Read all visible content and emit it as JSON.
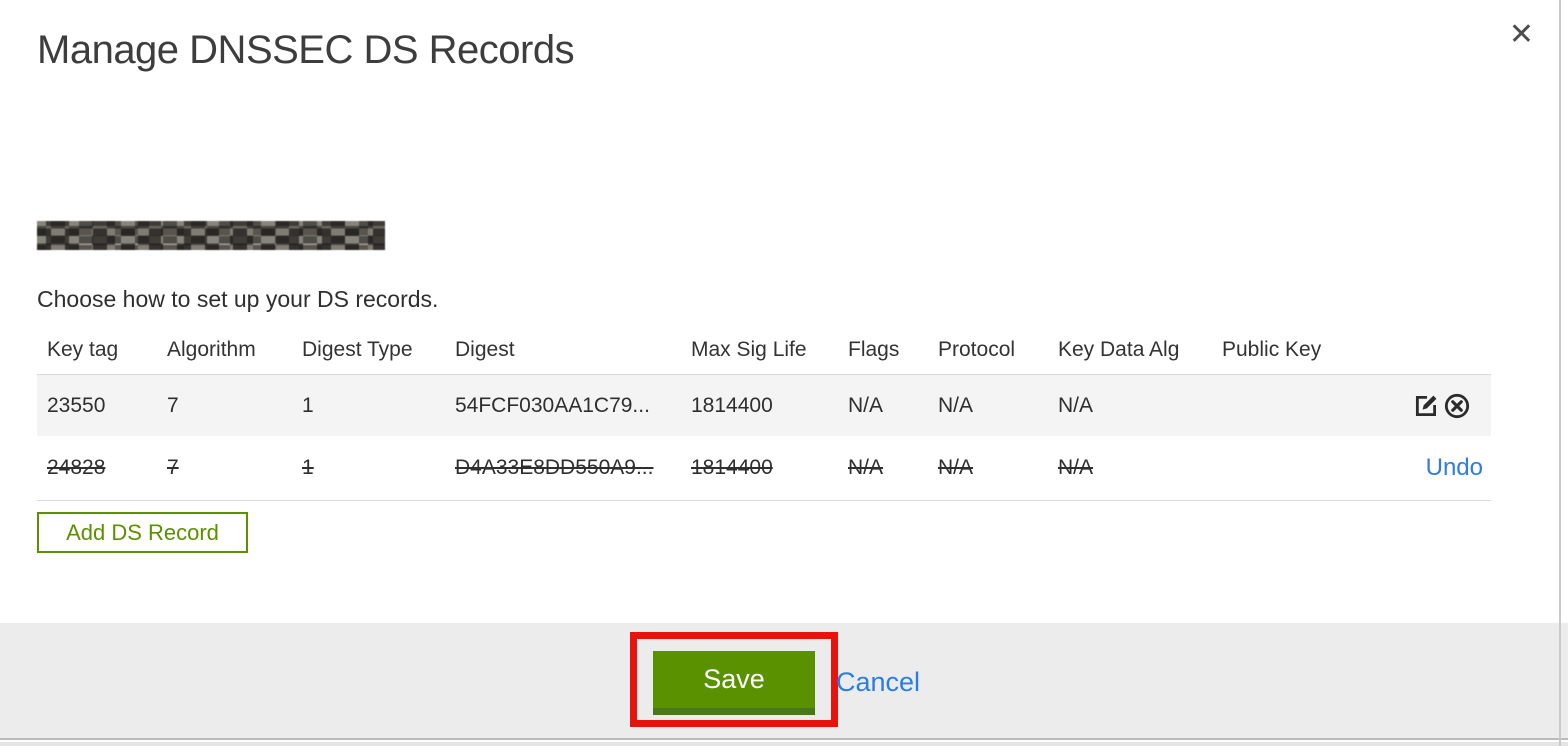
{
  "modal": {
    "title": "Manage DNSSEC DS Records",
    "close_icon": "✕",
    "subtitle": "Choose how to set up your DS records.",
    "domain_name_redacted": "pixelated-blurred-domain"
  },
  "table": {
    "headers": [
      "Key tag",
      "Algorithm",
      "Digest Type",
      "Digest",
      "Max Sig Life",
      "Flags",
      "Protocol",
      "Key Data Alg",
      "Public Key"
    ],
    "rows": [
      {
        "key_tag": "23550",
        "algorithm": "7",
        "digest_type": "1",
        "digest": "54FCF030AA1C79...",
        "max_sig_life": "1814400",
        "flags": "N/A",
        "protocol": "N/A",
        "key_data_alg": "N/A",
        "public_key": "",
        "state": "normal",
        "action_icons": [
          "edit-icon",
          "delete-icon"
        ]
      },
      {
        "key_tag": "24828",
        "algorithm": "7",
        "digest_type": "1",
        "digest": "D4A33E8DD550A9...",
        "max_sig_life": "1814400",
        "flags": "N/A",
        "protocol": "N/A",
        "key_data_alg": "N/A",
        "public_key": "",
        "state": "deleted-strikethrough",
        "undo_label": "Undo"
      }
    ]
  },
  "buttons": {
    "add_ds_record": "Add DS Record",
    "save": "Save",
    "cancel": "Cancel"
  },
  "annotations": {
    "save_highlight": "red-rectangle-around-save-button"
  },
  "colors": {
    "green": "#5a9100",
    "green_border_dark": "#4a771c",
    "outline_green": "#5c9000",
    "red_annotation": "#e8140c",
    "link_blue": "#2e7de1",
    "row_alt_bg": "#f4f4f4",
    "footer_bg": "#ececec"
  }
}
